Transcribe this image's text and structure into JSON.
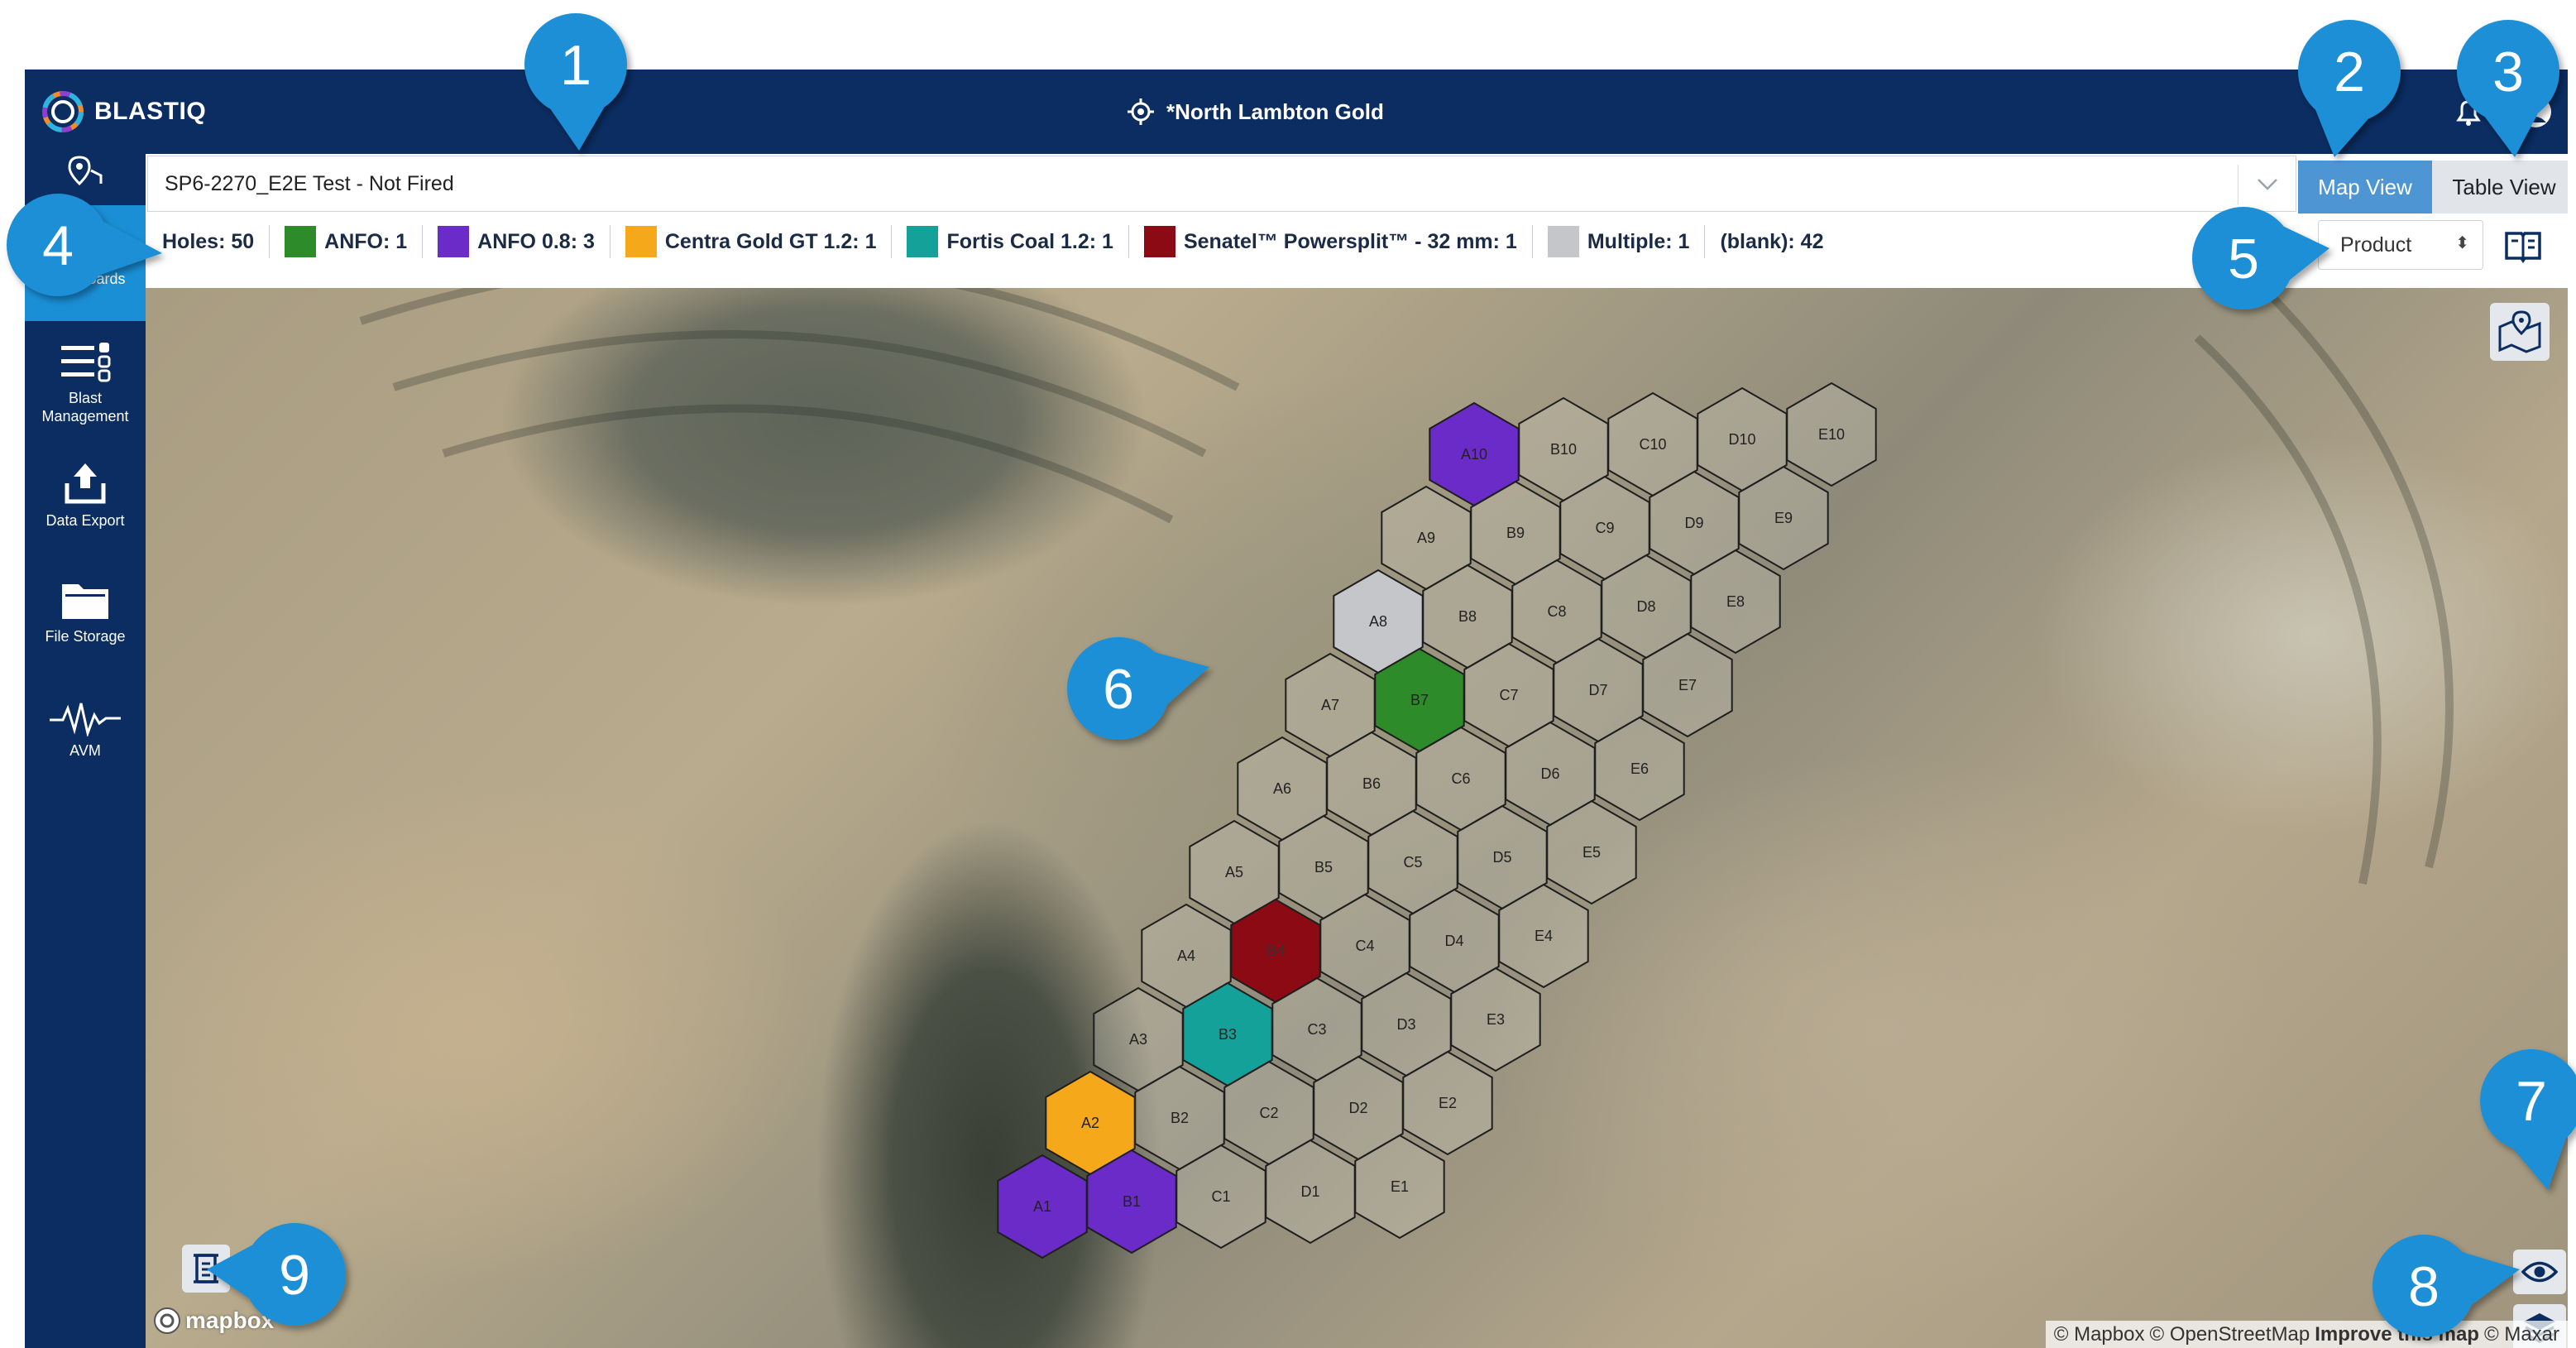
{
  "app": {
    "brand": "BLASTIQ",
    "site_name": "*North Lambton Gold"
  },
  "sidebar": {
    "items": [
      {
        "label": "Dashboards",
        "icon": "dashboard-chart-icon"
      },
      {
        "label": "Blast Management",
        "icon": "blast-management-icon"
      },
      {
        "label": "Data Export",
        "icon": "upload-icon"
      },
      {
        "label": "File Storage",
        "icon": "folder-icon"
      },
      {
        "label": "AVM",
        "icon": "waveform-icon"
      }
    ]
  },
  "toolbar": {
    "blast_selected": "SP6-2270_E2E Test - Not Fired",
    "view_map": "Map View",
    "view_table": "Table View",
    "color_by": "Product"
  },
  "legend": {
    "holes": "Holes: 50",
    "items": [
      {
        "label": "ANFO: 1",
        "color": "#2e8b2a"
      },
      {
        "label": "ANFO 0.8: 3",
        "color": "#6b2bc9"
      },
      {
        "label": "Centra Gold GT 1.2: 1",
        "color": "#f5a91a"
      },
      {
        "label": "Fortis Coal 1.2: 1",
        "color": "#13a19a"
      },
      {
        "label": "Senatel™ Powersplit™ - 32 mm: 1",
        "color": "#8b0a14"
      },
      {
        "label": "Multiple: 1",
        "color": "#c4c6c9"
      }
    ],
    "blank": "(blank): 42"
  },
  "map": {
    "holes": [
      {
        "id": "A1",
        "product": "ANFO 0.8"
      },
      {
        "id": "A2",
        "product": "Centra Gold GT 1.2"
      },
      {
        "id": "A3",
        "product": ""
      },
      {
        "id": "A4",
        "product": ""
      },
      {
        "id": "A5",
        "product": ""
      },
      {
        "id": "A6",
        "product": ""
      },
      {
        "id": "A7",
        "product": ""
      },
      {
        "id": "A8",
        "product": "Multiple"
      },
      {
        "id": "A9",
        "product": ""
      },
      {
        "id": "A10",
        "product": "ANFO 0.8"
      },
      {
        "id": "B1",
        "product": "ANFO 0.8"
      },
      {
        "id": "B2",
        "product": ""
      },
      {
        "id": "B3",
        "product": "Fortis Coal 1.2"
      },
      {
        "id": "B4",
        "product": "Senatel™ Powersplit™ - 32 mm"
      },
      {
        "id": "B5",
        "product": ""
      },
      {
        "id": "B6",
        "product": ""
      },
      {
        "id": "B7",
        "product": "ANFO"
      },
      {
        "id": "B8",
        "product": ""
      },
      {
        "id": "B9",
        "product": ""
      },
      {
        "id": "B10",
        "product": ""
      },
      {
        "id": "C1",
        "product": ""
      },
      {
        "id": "C2",
        "product": ""
      },
      {
        "id": "C3",
        "product": ""
      },
      {
        "id": "C4",
        "product": ""
      },
      {
        "id": "C5",
        "product": ""
      },
      {
        "id": "C6",
        "product": ""
      },
      {
        "id": "C7",
        "product": ""
      },
      {
        "id": "C8",
        "product": ""
      },
      {
        "id": "C9",
        "product": ""
      },
      {
        "id": "C10",
        "product": ""
      },
      {
        "id": "D1",
        "product": ""
      },
      {
        "id": "D2",
        "product": ""
      },
      {
        "id": "D3",
        "product": ""
      },
      {
        "id": "D4",
        "product": ""
      },
      {
        "id": "D5",
        "product": ""
      },
      {
        "id": "D6",
        "product": ""
      },
      {
        "id": "D7",
        "product": ""
      },
      {
        "id": "D8",
        "product": ""
      },
      {
        "id": "D9",
        "product": ""
      },
      {
        "id": "D10",
        "product": ""
      },
      {
        "id": "E1",
        "product": ""
      },
      {
        "id": "E2",
        "product": ""
      },
      {
        "id": "E3",
        "product": ""
      },
      {
        "id": "E4",
        "product": ""
      },
      {
        "id": "E5",
        "product": ""
      },
      {
        "id": "E6",
        "product": ""
      },
      {
        "id": "E7",
        "product": ""
      },
      {
        "id": "E8",
        "product": ""
      },
      {
        "id": "E9",
        "product": ""
      },
      {
        "id": "E10",
        "product": ""
      }
    ],
    "brand": "mapbox",
    "attribution": {
      "mapbox": "© Mapbox",
      "osm": "© OpenStreetMap",
      "improve": "Improve this map",
      "maxar": "© Maxar"
    }
  },
  "callouts": [
    "1",
    "2",
    "3",
    "4",
    "5",
    "6",
    "7",
    "8",
    "9"
  ],
  "colors": {
    "nav_bg": "#0b2d62",
    "accent": "#1a8fd6",
    "callout": "#1a8fd6"
  }
}
